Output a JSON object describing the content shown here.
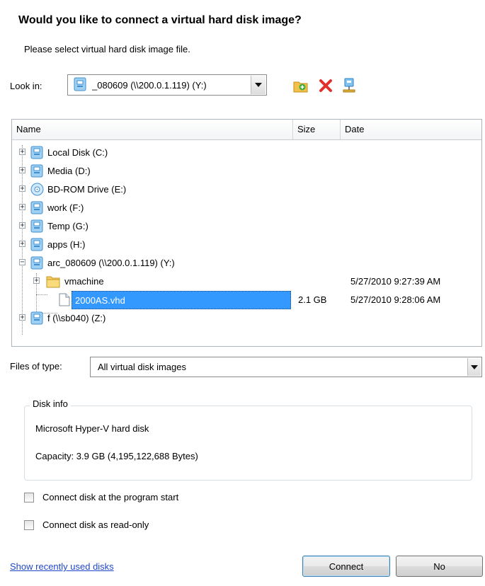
{
  "dialog": {
    "title": "Would you like to connect a virtual hard disk image?",
    "subtitle": "Please select virtual hard disk image file."
  },
  "look_in": {
    "label": "Look in:",
    "value": "_080609 (\\\\200.0.1.119) (Y:)",
    "toolbar_icons": [
      "new-folder-icon",
      "delete-icon",
      "network-drive-icon"
    ]
  },
  "file_list": {
    "columns": [
      "Name",
      "Size",
      "Date"
    ],
    "items": [
      {
        "name": "Local Disk (C:)",
        "icon": "drive-icon",
        "expander": "+",
        "size": "",
        "date": ""
      },
      {
        "name": "Media (D:)",
        "icon": "drive-icon",
        "expander": "+",
        "size": "",
        "date": ""
      },
      {
        "name": "BD-ROM Drive (E:)",
        "icon": "optical-drive-icon",
        "expander": "+",
        "size": "",
        "date": ""
      },
      {
        "name": "work (F:)",
        "icon": "drive-icon",
        "expander": "+",
        "size": "",
        "date": ""
      },
      {
        "name": "Temp (G:)",
        "icon": "drive-icon",
        "expander": "+",
        "size": "",
        "date": ""
      },
      {
        "name": "apps (H:)",
        "icon": "drive-icon",
        "expander": "+",
        "size": "",
        "date": ""
      },
      {
        "name": "arc_080609 (\\\\200.0.1.119) (Y:)",
        "icon": "drive-icon",
        "expander": "−",
        "size": "",
        "date": ""
      },
      {
        "name": "vmachine",
        "icon": "folder-icon",
        "expander": "+",
        "size": "",
        "date": "5/27/2010 9:27:39 AM"
      },
      {
        "name": "2000AS.vhd",
        "icon": "file-icon",
        "expander": "",
        "size": "2.1 GB",
        "date": "5/27/2010 9:28:06 AM",
        "selected": true
      },
      {
        "name": "f (\\\\sb040) (Z:)",
        "icon": "drive-icon",
        "expander": "+",
        "size": "",
        "date": ""
      }
    ]
  },
  "files_of_type": {
    "label": "Files of type:",
    "value": "All virtual disk images"
  },
  "disk_info": {
    "title": "Disk info",
    "type": "Microsoft Hyper-V hard disk",
    "capacity": "Capacity:  3.9 GB (4,195,122,688 Bytes)"
  },
  "options": {
    "connect_at_start": {
      "label": "Connect disk at the program start",
      "checked": false
    },
    "read_only": {
      "label": "Connect disk as read-only",
      "checked": false
    }
  },
  "footer": {
    "link": "Show recently used disks",
    "connect": "Connect",
    "no": "No"
  },
  "colors": {
    "selection": "#3399ff",
    "link": "#1f47c9"
  }
}
